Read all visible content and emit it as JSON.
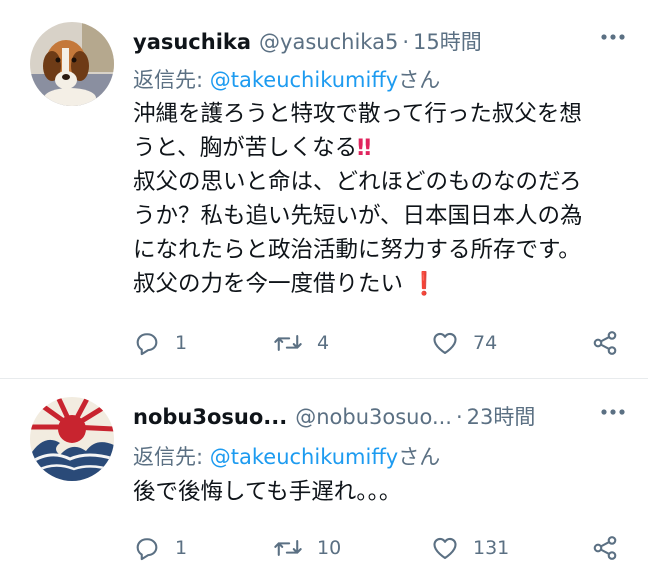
{
  "tweets": [
    {
      "name": "yasuchika",
      "handle": "@yasuchika5",
      "separator": "·",
      "time": "15時間",
      "reply_prefix": "返信先: ",
      "reply_to": "@takeuchikumiffy",
      "reply_suffix": "さん",
      "body_lines": [
        "沖縄を護ろうと特攻で散って行った叔父を想",
        "うと、胸が苦しくなる",
        "叔父の思いと命は、どれほどのものなのだろ",
        "うか？私も追い先短いが、日本国日本人の為",
        "になれたらと政治活動に努力する所存です。",
        "叔父の力を今一度借りたい "
      ],
      "emoji_1": "‼",
      "emoji_2": "❗",
      "replies": "1",
      "retweets": "4",
      "likes": "74",
      "avatar": "dog-photo-avatar"
    },
    {
      "name": "nobu3osuo...",
      "handle": "@nobu3osuo...",
      "separator": "·",
      "time": "23時間",
      "reply_prefix": "返信先: ",
      "reply_to": "@takeuchikumiffy",
      "reply_suffix": "さん",
      "body_lines": [
        "後で後悔しても手遅れ。。。"
      ],
      "replies": "1",
      "retweets": "10",
      "likes": "131",
      "avatar": "rising-sun-wave-avatar"
    }
  ],
  "icons": {
    "more": "more-dots-icon",
    "reply": "reply-bubble-icon",
    "retweet": "retweet-arrows-icon",
    "like": "heart-icon",
    "share": "share-icon"
  },
  "colors": {
    "text": "#0f1419",
    "secondary": "#5b7083",
    "mention": "#1d9bf0",
    "emoji_red": "#e0245e",
    "divider": "#e8ebed"
  }
}
